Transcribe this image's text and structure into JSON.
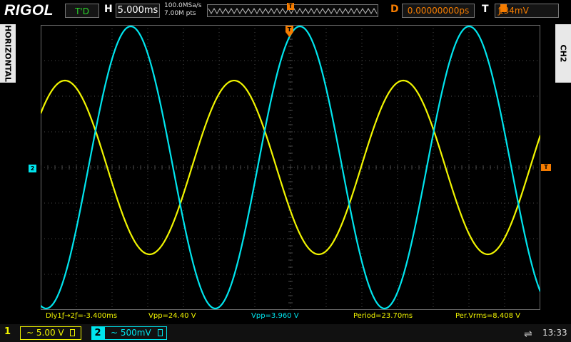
{
  "header": {
    "brand": "RIGOL",
    "run_state": "T'D",
    "horizontal_label": "H",
    "timebase": "5.000ms",
    "sample_rate": "100.0MSa/s",
    "memory_depth": "7.00M pts",
    "delay_label": "D",
    "delay_value": "0.00000000ps",
    "trigger_label": "T",
    "trigger_edge": "ƒ",
    "trigger_level": "134mV"
  },
  "side_tabs": {
    "left": "HORIZONTAL",
    "right": "CH2"
  },
  "markers": {
    "ch2_ground": "2",
    "trigger_level": "T",
    "trigger_position": "T"
  },
  "measurements": [
    "Dly1ƒ→2ƒ=-3.400ms",
    "Vpp=24.40 V",
    "Vpp=3.960 V",
    "Period=23.70ms",
    "Per.Vrms=8.408 V"
  ],
  "channels": {
    "ch1": {
      "number": "1",
      "coupling": "~",
      "scale": "5.00 V"
    },
    "ch2": {
      "number": "2",
      "coupling": "~",
      "scale": "500mV"
    }
  },
  "status": {
    "usb": "⇌",
    "time": "13:33"
  },
  "colors": {
    "ch1": "#f1f500",
    "ch2": "#00e5ee",
    "trigger": "#f57c00",
    "grid": "#4a4a4a"
  },
  "chart_data": {
    "type": "line",
    "xlabel": "",
    "ylabel": "",
    "x_unit": "ms",
    "xlim": [
      -35,
      35
    ],
    "grid": true,
    "series": [
      {
        "name": "",
        "channel": "1",
        "period_ms": 23.7,
        "amplitude_div": 2.44,
        "offset_div": 0,
        "phase_deg": 210
      },
      {
        "name": "",
        "channel": "2",
        "period_ms": 23.7,
        "amplitude_div": 3.96,
        "offset_div": 0,
        "phase_deg": 70
      }
    ]
  }
}
